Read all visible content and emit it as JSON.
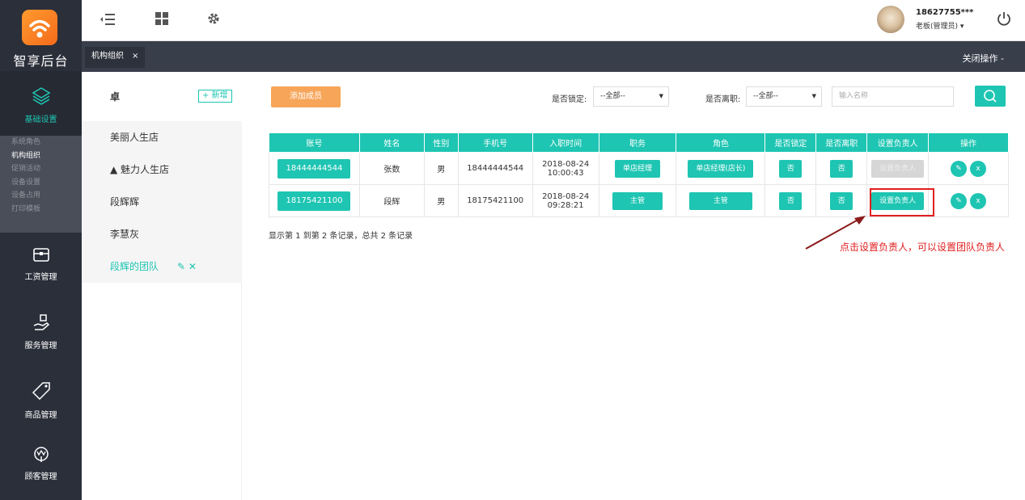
{
  "app": {
    "logo_text": "智享后台"
  },
  "sidebar": {
    "basic_settings": "基础设置",
    "submenu": [
      "系统角色",
      "机构组织",
      "促销活动",
      "设备设置",
      "设备占用",
      "打印模板"
    ],
    "active_sub": 1,
    "sections": [
      "工资管理",
      "服务管理",
      "商品管理",
      "顾客管理"
    ]
  },
  "topbar": {
    "user_id": "18627755***",
    "user_role": "老板(管理员) ▾"
  },
  "tabs": {
    "active_tab": "机构组织",
    "close_label": "×",
    "close_ops": "关闭操作 -"
  },
  "tree": {
    "title": "卓",
    "add_label": "+ 新增",
    "items": [
      {
        "label": "美丽人生店"
      },
      {
        "label": "▲  魅力人生店"
      },
      {
        "label": "段辉辉"
      },
      {
        "label": "李慧灰"
      },
      {
        "label": "段辉的团队"
      }
    ],
    "edit_icons": "✎  ✕"
  },
  "toolbar": {
    "add_member": "添加成员",
    "locked_label": "是否锁定:",
    "locked_value": "--全部--",
    "resigned_label": "是否离职:",
    "resigned_value": "--全部--",
    "name_placeholder": "输入名称"
  },
  "table": {
    "headers": [
      "账号",
      "姓名",
      "性别",
      "手机号",
      "入职时间",
      "职务",
      "角色",
      "是否锁定",
      "是否离职",
      "设置负责人",
      "操作"
    ],
    "rows": [
      {
        "account": "18444444544",
        "name": "张数",
        "gender": "男",
        "phone": "18444444544",
        "date": "2018-08-24",
        "time": "10:00:43",
        "position": "单店经理",
        "role": "单店经理(店长)",
        "locked": "否",
        "resigned": "否",
        "set_manager": "设置负责人",
        "edit": "✎",
        "delete": "x"
      },
      {
        "account": "18175421100",
        "name": "段辉",
        "gender": "男",
        "phone": "18175421100",
        "date": "2018-08-24",
        "time": "09:28:21",
        "position": "主管",
        "role": "主管",
        "locked": "否",
        "resigned": "否",
        "set_manager": "设置负责人",
        "edit": "✎",
        "delete": "x"
      }
    ],
    "record_info": "显示第 1 到第 2 条记录，总共 2 条记录"
  },
  "annotation": "点击设置负责人，可以设置团队负责人",
  "colors": {
    "accent": "#1ec5b2",
    "sidebar": "#2b2f3a",
    "orange": "#f7a559",
    "annotation": "#e02020"
  }
}
